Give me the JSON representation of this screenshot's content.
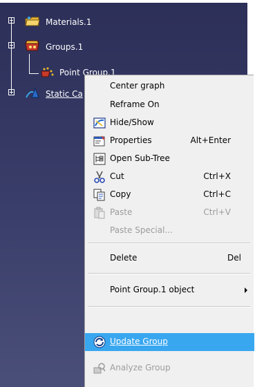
{
  "tree": {
    "items": [
      {
        "label": "Materials.1",
        "icon": "folder-icon"
      },
      {
        "label": "Groups.1",
        "icon": "groups-icon"
      },
      {
        "label": "Point Group.1",
        "icon": "point-group-icon"
      },
      {
        "label": "Static Ca",
        "icon": "static-case-icon"
      }
    ]
  },
  "menu": {
    "items": [
      {
        "label": "Center graph",
        "shortcut": "",
        "enabled": true
      },
      {
        "label": "Reframe On",
        "shortcut": "",
        "enabled": true
      },
      {
        "label": "Hide/Show",
        "shortcut": "",
        "enabled": true,
        "icon": "hide-show-icon"
      },
      {
        "label": "Properties",
        "shortcut": "Alt+Enter",
        "enabled": true,
        "icon": "properties-icon"
      },
      {
        "label": "Open Sub-Tree",
        "shortcut": "",
        "enabled": true,
        "icon": "sub-tree-icon"
      },
      {
        "label": "Cut",
        "shortcut": "Ctrl+X",
        "enabled": true,
        "icon": "scissors-icon"
      },
      {
        "label": "Copy",
        "shortcut": "Ctrl+C",
        "enabled": true,
        "icon": "copy-icon"
      },
      {
        "label": "Paste",
        "shortcut": "Ctrl+V",
        "enabled": false,
        "icon": "paste-icon"
      },
      {
        "label": "Paste Special...",
        "shortcut": "",
        "enabled": false
      },
      {
        "label": "Delete",
        "shortcut": "Del",
        "enabled": true
      },
      {
        "label": "Point Group.1 object",
        "shortcut": "",
        "enabled": true,
        "submenu": true
      },
      {
        "label": "Update Group",
        "shortcut": "",
        "enabled": true,
        "highlighted": true,
        "icon": "update-icon"
      },
      {
        "label": "Analyze Group",
        "shortcut": "",
        "enabled": false,
        "icon": "analyze-icon"
      }
    ]
  },
  "colors": {
    "tree_bg": "#2c2f57",
    "highlight": "#39a7f0"
  }
}
